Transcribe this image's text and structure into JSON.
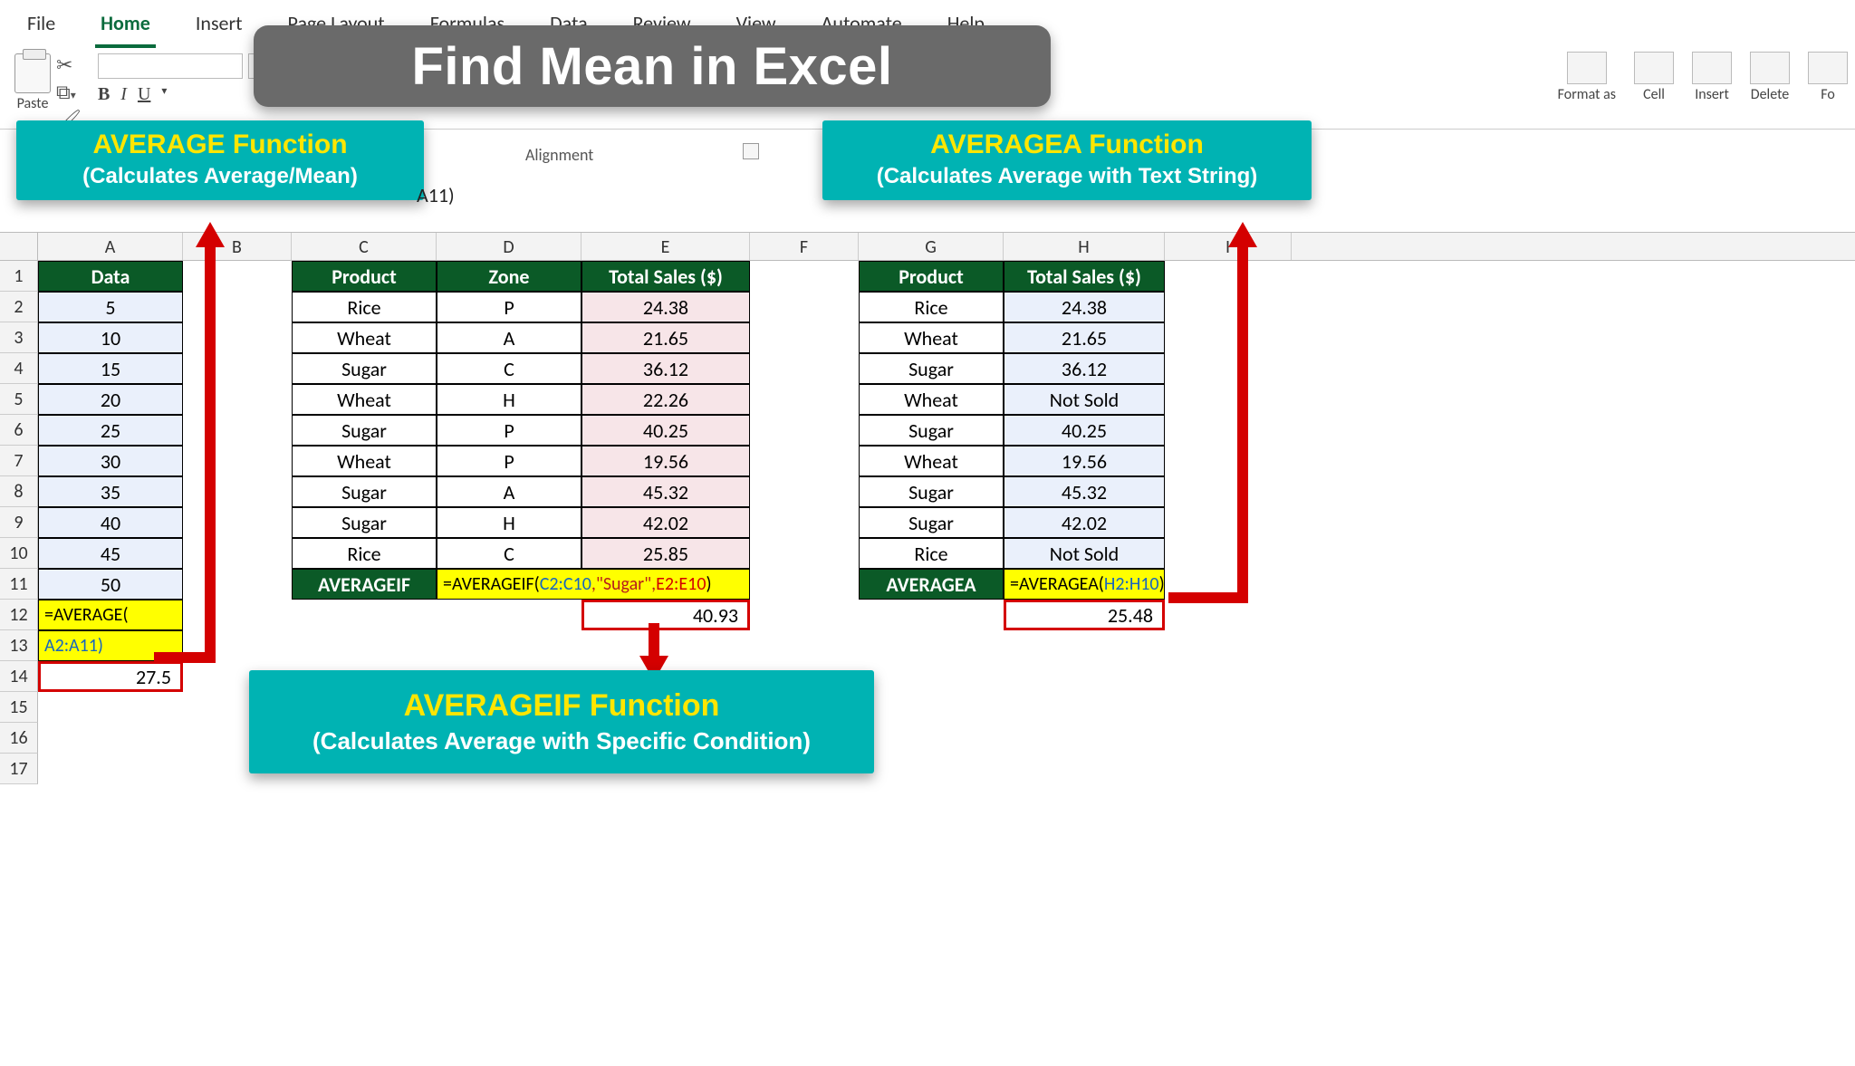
{
  "menu": {
    "file": "File",
    "home": "Home",
    "insert": "Insert",
    "page_layout": "Page Layout",
    "formulas": "Formulas",
    "data": "Data",
    "review": "Review",
    "view": "View",
    "automate": "Automate",
    "help": "Help"
  },
  "clipboard": {
    "paste": "Paste"
  },
  "font_btns": {
    "b": "B",
    "i": "I",
    "u": "U"
  },
  "ribbon_right": {
    "format_as": "Format as",
    "cell": "Cell",
    "insert": "Insert",
    "delete": "Delete",
    "format": "Fo"
  },
  "banner": "Find Mean in Excel",
  "labels": {
    "avg": {
      "title": "AVERAGE Function",
      "sub": "(Calculates Average/Mean)"
    },
    "avgif": {
      "title": "AVERAGEIF Function",
      "sub": "(Calculates Average with Specific Condition)"
    },
    "avga": {
      "title": "AVERAGEA Function",
      "sub": "(Calculates Average with Text String)"
    }
  },
  "alignment_label": "Alignment",
  "formula_bar_frag": "A11)",
  "columns": {
    "A": "A",
    "B": "B",
    "C": "C",
    "D": "D",
    "E": "E",
    "F": "F",
    "G": "G",
    "H": "H",
    "I": "I"
  },
  "rows": [
    "1",
    "2",
    "3",
    "4",
    "5",
    "6",
    "7",
    "8",
    "9",
    "10",
    "11",
    "12",
    "13",
    "14",
    "15",
    "16",
    "17"
  ],
  "tableA": {
    "header": "Data",
    "values": [
      "5",
      "10",
      "15",
      "20",
      "25",
      "30",
      "35",
      "40",
      "45",
      "50"
    ],
    "formula_l1": "=AVERAGE(",
    "formula_l2": "A2:A11)",
    "result": "27.5"
  },
  "tableCDE": {
    "headers": {
      "c": "Product",
      "d": "Zone",
      "e": "Total Sales ($)"
    },
    "rows": [
      {
        "c": "Rice",
        "d": "P",
        "e": "24.38"
      },
      {
        "c": "Wheat",
        "d": "A",
        "e": "21.65"
      },
      {
        "c": "Sugar",
        "d": "C",
        "e": "36.12"
      },
      {
        "c": "Wheat",
        "d": "H",
        "e": "22.26"
      },
      {
        "c": "Sugar",
        "d": "P",
        "e": "40.25"
      },
      {
        "c": "Wheat",
        "d": "P",
        "e": "19.56"
      },
      {
        "c": "Sugar",
        "d": "A",
        "e": "45.32"
      },
      {
        "c": "Sugar",
        "d": "H",
        "e": "42.02"
      },
      {
        "c": "Rice",
        "d": "C",
        "e": "25.85"
      }
    ],
    "func_label": "AVERAGEIF",
    "formula_pre": "=AVERAGEIF(",
    "formula_ref1": "C2:C10",
    "formula_lit": ",\"Sugar\",",
    "formula_ref2": "E2:E10",
    "formula_post": ")",
    "result": "40.93"
  },
  "tableGH": {
    "headers": {
      "g": "Product",
      "h": "Total Sales ($)"
    },
    "rows": [
      {
        "g": "Rice",
        "h": "24.38"
      },
      {
        "g": "Wheat",
        "h": "21.65"
      },
      {
        "g": "Sugar",
        "h": "36.12"
      },
      {
        "g": "Wheat",
        "h": "Not Sold"
      },
      {
        "g": "Sugar",
        "h": "40.25"
      },
      {
        "g": "Wheat",
        "h": "19.56"
      },
      {
        "g": "Sugar",
        "h": "45.32"
      },
      {
        "g": "Sugar",
        "h": "42.02"
      },
      {
        "g": "Rice",
        "h": "Not Sold"
      }
    ],
    "func_label": "AVERAGEA",
    "formula_pre": "=AVERAGEA(",
    "formula_ref": "H2:H10",
    "formula_post": ")",
    "result": "25.48"
  }
}
